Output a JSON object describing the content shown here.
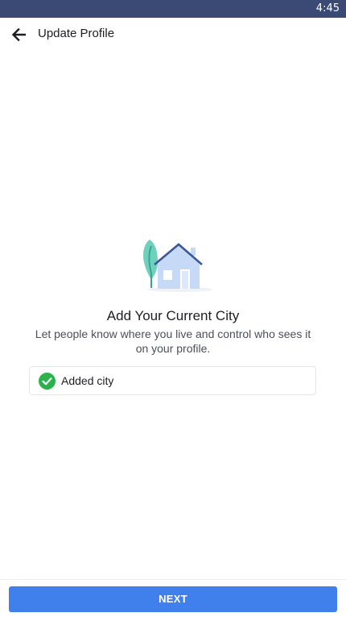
{
  "status_bar": {
    "time": "4:45"
  },
  "app_bar": {
    "title": "Update Profile",
    "back_icon": "arrow-left-icon"
  },
  "main": {
    "illustration": "house-with-tree-illustration",
    "heading": "Add Your Current City",
    "description": "Let people know where you live and control who sees it on your profile.",
    "city_item": {
      "label": "Added city",
      "icon": "check-circle-icon",
      "icon_color": "#2bb24c"
    }
  },
  "footer": {
    "next_label": "NEXT"
  },
  "colors": {
    "status_bar": "#3a4a74",
    "accent": "#4080ec"
  }
}
